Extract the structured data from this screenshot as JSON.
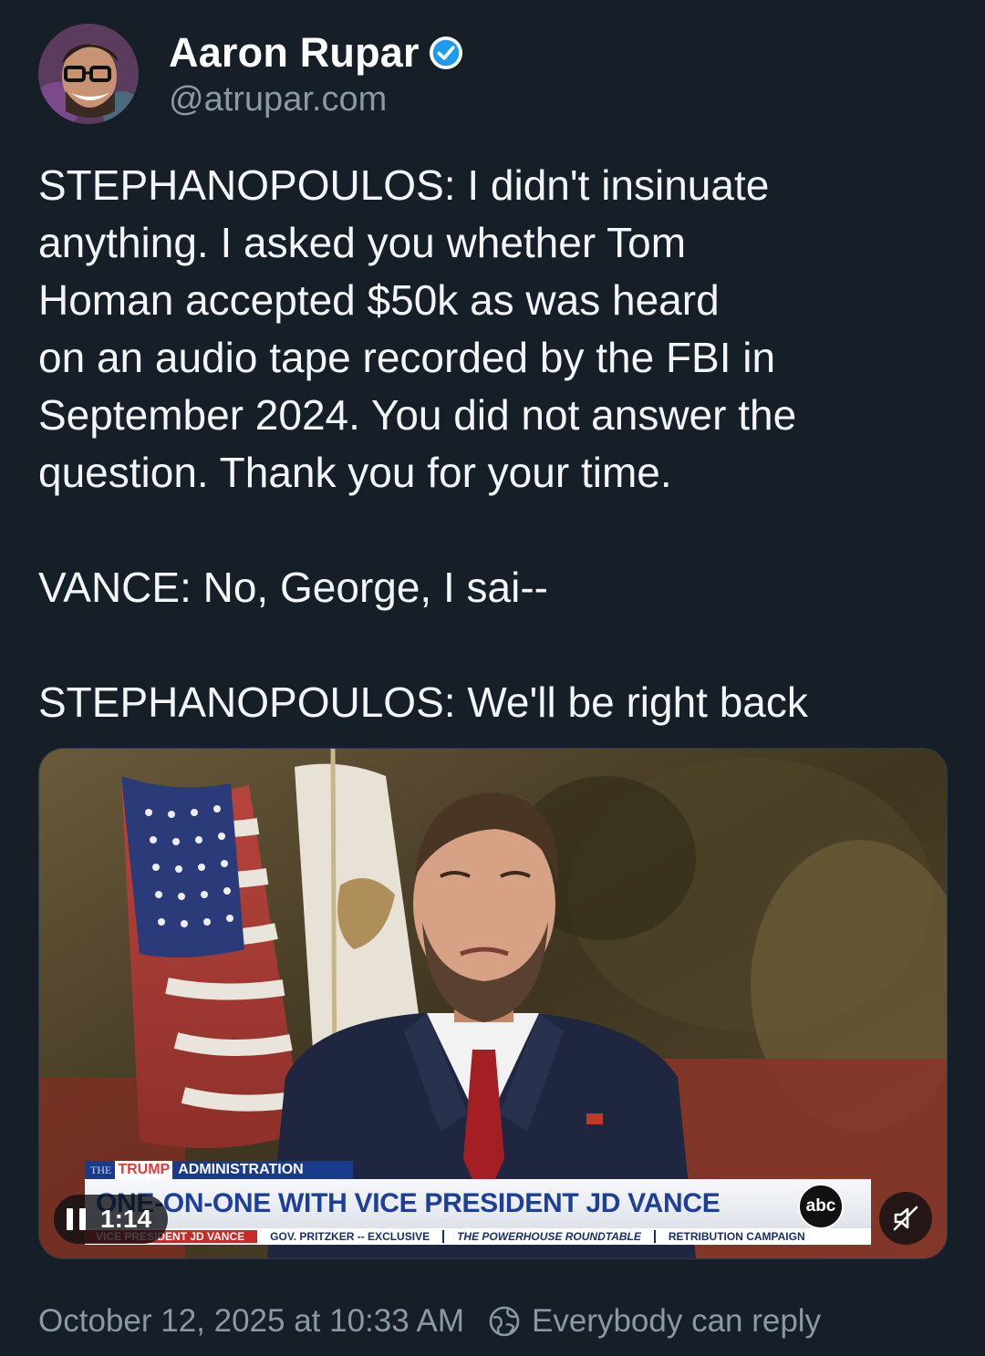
{
  "author": {
    "name": "Aaron Rupar",
    "handle": "@atrupar.com",
    "verified": true,
    "avatar_icon": "person-with-glasses-avatar",
    "verified_color": "#1d9bf0"
  },
  "post": {
    "text": "STEPHANOPOULOS: I didn't insinuate\nanything. I asked you whether Tom\nHoman accepted $50k as was heard\non an audio tape recorded by the FBI in\nSeptember 2024. You did not answer the\nquestion. Thank you for your time.\n\nVANCE: No, George, I sai--\n\nSTEPHANOPOULOS: We'll be right back"
  },
  "video": {
    "lower_third": {
      "top_small": "THE",
      "top_trump": "TRUMP",
      "top_admin": "ADMINISTRATION",
      "headline": "ONE-ON-ONE WITH VICE PRESIDENT JD VANCE",
      "network": "abc",
      "ticker": [
        "VICE PRESIDENT JD VANCE",
        "GOV. PRITZKER -- EXCLUSIVE",
        "THE POWERHOUSE ROUNDTABLE",
        "RETRIBUTION CAMPAIGN"
      ]
    },
    "time": "1:14",
    "state": "playing",
    "pause_icon": "pause-icon",
    "mute_icon": "muted-speaker-icon"
  },
  "footer": {
    "timestamp": "October 12, 2025 at 10:33 AM",
    "reply_setting": "Everybody can reply",
    "reply_icon": "globe-reply-icon"
  },
  "colors": {
    "background": "#161e27",
    "text": "#f3f5f7",
    "muted": "#8b98a5",
    "accent_blue": "#1d9bf0"
  }
}
